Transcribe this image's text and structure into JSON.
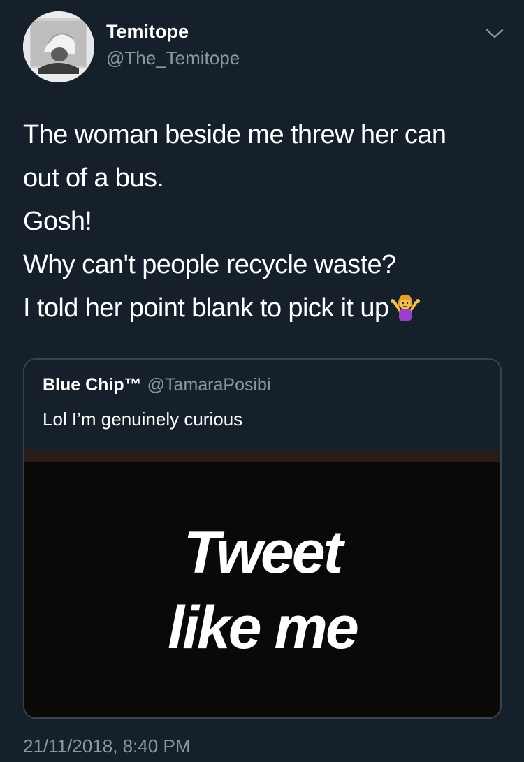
{
  "author": {
    "name": "Temitope",
    "handle": "@The_Temitope"
  },
  "tweet": {
    "lines": [
      "The woman beside me threw her can",
      "out of a bus.",
      "Gosh!",
      "Why can't people recycle waste?",
      "I told her point blank to pick it up"
    ],
    "emoji": "woman-shrugging-emoji"
  },
  "quoted_tweet": {
    "name": "Blue Chip™",
    "handle": "@TamaraPosibi",
    "text": "Lol I’m genuinely curious",
    "media_text": [
      "Tweet",
      "like me"
    ]
  },
  "timestamp": "21/11/2018, 8:40 PM",
  "colors": {
    "background": "#15202b",
    "secondary_text": "#8899a6",
    "border": "#38444d"
  }
}
